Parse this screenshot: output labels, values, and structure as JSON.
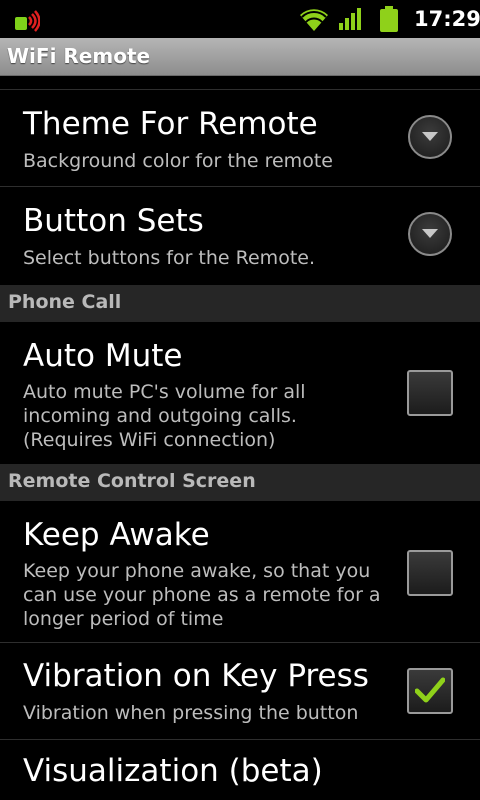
{
  "status_bar": {
    "time": "17:29"
  },
  "app": {
    "title": "WiFi Remote"
  },
  "prefs": {
    "theme": {
      "title": "Theme For Remote",
      "summary": "Background color for the remote"
    },
    "button_sets": {
      "title": "Button Sets",
      "summary": "Select buttons for the Remote."
    },
    "phone_call_category": "Phone Call",
    "auto_mute": {
      "title": "Auto Mute",
      "summary": "Auto mute PC's volume for all incoming and outgoing calls. (Requires WiFi connection)",
      "checked": false
    },
    "remote_screen_category": "Remote Control Screen",
    "keep_awake": {
      "title": "Keep Awake",
      "summary": "Keep your phone awake, so that you can use your phone as a remote for a longer period of time",
      "checked": false
    },
    "vibration": {
      "title": "Vibration on Key Press",
      "summary": "Vibration when pressing the button",
      "checked": true
    },
    "visualization": {
      "title": "Visualization (beta)"
    }
  },
  "colors": {
    "accent_green": "#8fd11a",
    "background": "#000000"
  },
  "icons": [
    "notification-icon",
    "wifi-icon",
    "signal-icon",
    "battery-icon",
    "dropdown-arrow-icon",
    "checkmark-icon"
  ]
}
